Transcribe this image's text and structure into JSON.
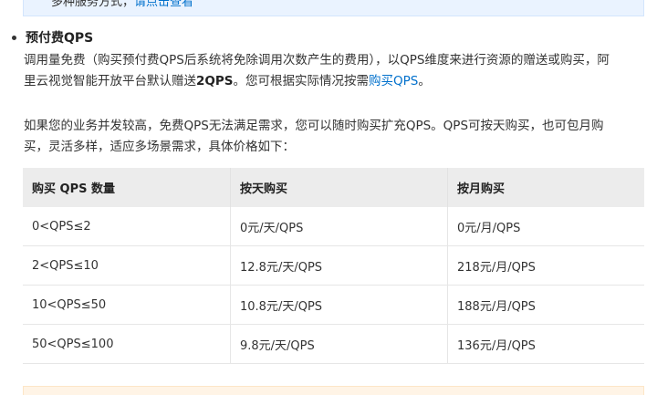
{
  "top_note": {
    "text": "多种服务方式，",
    "link": "请点击查看"
  },
  "section": {
    "title": "预付费QPS"
  },
  "para1": {
    "line1": "调用量免费（购买预付费QPS后系统将免除调用次数产生的费用），以QPS维度来进行资源的赠送或购买，阿",
    "line2_pre": "里云视觉智能开放平台默认赠送",
    "line2_bold": "2QPS",
    "line2_mid": "。您可根据实际情况按需",
    "line2_link": "购买QPS",
    "line2_end": "。"
  },
  "para2": {
    "line1": "如果您的业务并发较高，免费QPS无法满足需求，您可以随时购买扩充QPS。QPS可按天购买，也可包月购",
    "line2": "买，灵活多样，适应多场景需求，具体价格如下："
  },
  "table": {
    "headers": [
      "购买 QPS 数量",
      "按天购买",
      "按月购买"
    ],
    "rows": [
      [
        "0<QPS≤2",
        "0元/天/QPS",
        "0元/月/QPS"
      ],
      [
        "2<QPS≤10",
        "12.8元/天/QPS",
        "218元/月/QPS"
      ],
      [
        "10<QPS≤50",
        "10.8元/天/QPS",
        "188元/月/QPS"
      ],
      [
        "50<QPS≤100",
        "9.8元/天/QPS",
        "136元/月/QPS"
      ]
    ]
  },
  "colors": {
    "link": "#0070cc",
    "info_bg": "#eaf3ff",
    "warn_bg": "#fff4e6",
    "header_bg": "#ececec"
  }
}
